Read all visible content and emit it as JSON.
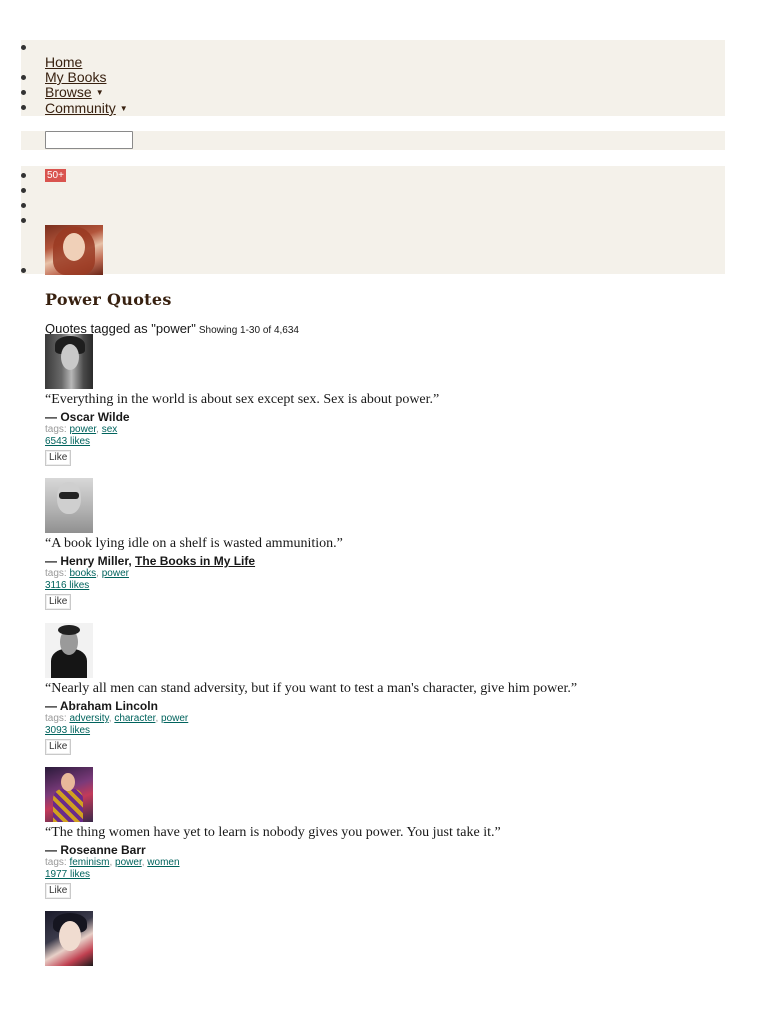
{
  "nav": {
    "items": [
      {
        "label": "Home",
        "dropdown": false
      },
      {
        "label": "My Books",
        "dropdown": false
      },
      {
        "label": "Browse",
        "dropdown": true
      },
      {
        "label": "Community",
        "dropdown": true
      }
    ],
    "dropdown_icon": "caret-down-icon"
  },
  "search": {
    "value": "",
    "placeholder": ""
  },
  "personal": {
    "notification_count": "50+",
    "notification_color": "#d9544f",
    "avatar_icon": "user-avatar"
  },
  "page": {
    "title": "Power Quotes",
    "tagged_label": "Quotes tagged as \"power\"",
    "showing_label": "Showing 1-30 of 4,634"
  },
  "colors": {
    "band_background": "#f4f1ea",
    "heading": "#382110",
    "link": "#00635d"
  },
  "quotes": [
    {
      "text": "“Everything in the world is about sex except sex. Sex is about power.”",
      "author": "— Oscar Wilde",
      "book": "",
      "tags_label": "tags:",
      "tags": [
        "power",
        "sex"
      ],
      "likes": "6543 likes",
      "like_button": "Like"
    },
    {
      "text": "“A book lying idle on a shelf is wasted ammunition.”",
      "author": "— Henry Miller,",
      "book": "The Books in My Life",
      "tags_label": "tags:",
      "tags": [
        "books",
        "power"
      ],
      "likes": "3116 likes",
      "like_button": "Like"
    },
    {
      "text": "“Nearly all men can stand adversity, but if you want to test a man's character, give him power.”",
      "author": "— Abraham Lincoln",
      "book": "",
      "tags_label": "tags:",
      "tags": [
        "adversity",
        "character",
        "power"
      ],
      "likes": "3093 likes",
      "like_button": "Like"
    },
    {
      "text": "“The thing women have yet to learn is nobody gives you power. You just take it.”",
      "author": "— Roseanne Barr",
      "book": "",
      "tags_label": "tags:",
      "tags": [
        "feminism",
        "power",
        "women"
      ],
      "likes": "1977 likes",
      "like_button": "Like"
    }
  ]
}
